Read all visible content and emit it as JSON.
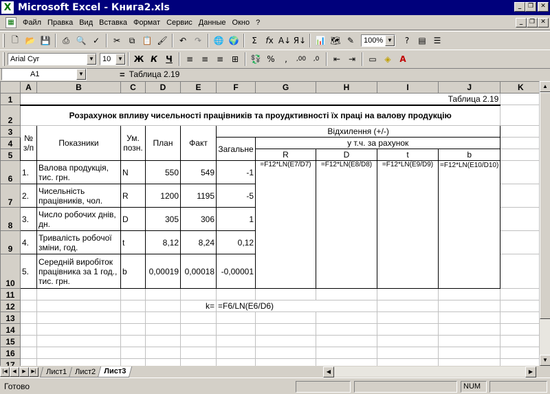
{
  "window": {
    "title": "Microsoft Excel - Книга2.xls",
    "app_icon": "X"
  },
  "menu": [
    "Файл",
    "Правка",
    "Вид",
    "Вставка",
    "Формат",
    "Сервис",
    "Данные",
    "Окно",
    "?"
  ],
  "toolbar": {
    "zoom": "100%",
    "font_name": "Arial Cyr",
    "font_size": "10"
  },
  "formula_bar": {
    "cell_ref": "A1",
    "eq": "=",
    "value": "Таблица 2.19"
  },
  "columns": [
    "A",
    "B",
    "C",
    "D",
    "E",
    "F",
    "G",
    "H",
    "I",
    "J",
    "K"
  ],
  "rows": [
    "1",
    "2",
    "3",
    "4",
    "5",
    "6",
    "7",
    "8",
    "9",
    "10",
    "11",
    "12",
    "13",
    "14",
    "15",
    "16",
    "17"
  ],
  "cells": {
    "j1": "Таблица 2.19",
    "title": "Розрахунок впливу чисельності працівників та проудктивності їх праці на валову продукцію",
    "h_no": "№ з/п",
    "h_ind": "Показники",
    "h_unit": "Ум. позн.",
    "h_plan": "План",
    "h_fact": "Факт",
    "h_dev": "Відхилення (+/-)",
    "h_incl": "у т.ч. за рахунок",
    "h_total": "Загальне",
    "h_r": "R",
    "h_d": "D",
    "h_t": "t",
    "h_b": "b",
    "data": [
      {
        "no": "1.",
        "name": "Валова продукція, тис. грн.",
        "unit": "N",
        "plan": "550",
        "fact": "549",
        "dev": "-1",
        "g": "=F12*LN(E7/D7)",
        "h": "=F12*LN(E8/D8)",
        "i": "=F12*LN(E9/D9)",
        "j": "=F12*LN(E10/D10)"
      },
      {
        "no": "2.",
        "name": "Чисельність працівників, чол.",
        "unit": "R",
        "plan": "1200",
        "fact": "1195",
        "dev": "-5"
      },
      {
        "no": "3.",
        "name": "Число робочих днів, дн.",
        "unit": "D",
        "plan": "305",
        "fact": "306",
        "dev": "1"
      },
      {
        "no": "4.",
        "name": "Тривалість робочої зміни, год.",
        "unit": "t",
        "plan": "8,12",
        "fact": "8,24",
        "dev": "0,12"
      },
      {
        "no": "5.",
        "name": "Середній виробіток працівника за 1 год., тис. грн.",
        "unit": "b",
        "plan": "0,00019",
        "fact": "0,00018",
        "dev": "-0,00001"
      }
    ],
    "k_label": "k=",
    "k_formula": "=F6/LN(E6/D6)"
  },
  "sheet_tabs": [
    "Лист1",
    "Лист2",
    "Лист3"
  ],
  "status": {
    "ready": "Готово",
    "num": "NUM"
  }
}
